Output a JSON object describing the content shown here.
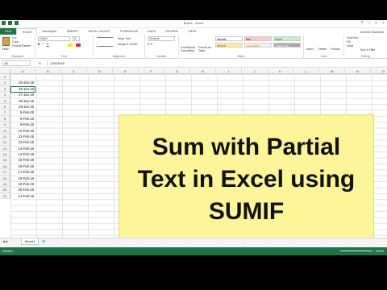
{
  "window": {
    "title": "Book1 - Excel",
    "controls": [
      "?",
      "–",
      "□",
      "×"
    ]
  },
  "ribbon_tabs": {
    "file": "FILE",
    "tabs": [
      "HOME",
      "Developer",
      "INSERT",
      "PAGE LAYOUT",
      "FORMULAS",
      "DATA",
      "REVIEW",
      "VIEW"
    ],
    "user": "Umesh Mohanta"
  },
  "ribbon": {
    "clipboard": {
      "paste": "Paste",
      "cut": "Cut",
      "copy": "Copy",
      "format_painter": "Format Painter",
      "label": "Clipboard"
    },
    "font": {
      "name": "Calibri",
      "size": "11",
      "label": "Font"
    },
    "alignment": {
      "wrap": "Wrap Text",
      "merge": "Merge & Center",
      "label": "Alignment"
    },
    "number": {
      "format": "General",
      "label": "Number"
    },
    "styles": {
      "conditional": "Conditional Formatting",
      "format_table": "Format as Table",
      "cells": [
        "Normal",
        "Bad",
        "Good",
        "Neutral",
        "Calculation",
        "Check Cell"
      ],
      "label": "Styles"
    },
    "cells": {
      "insert": "Insert",
      "delete": "Delete",
      "format": "Format",
      "label": "Cells"
    },
    "editing": {
      "autosum": "AutoSum",
      "fill": "Fill",
      "clear": "Clear",
      "sort": "Sort & Filter",
      "find": "Find & Select",
      "label": "Editing"
    }
  },
  "formula_bar": {
    "name_box": "A3",
    "fx": "fx",
    "value": "1/26/2018"
  },
  "columns": [
    "A",
    "B",
    "C",
    "D",
    "E",
    "F",
    "G",
    "H",
    "I",
    "J",
    "K",
    "L",
    "M",
    "N",
    "O"
  ],
  "rows": [
    "1",
    "2",
    "3",
    "4",
    "5",
    "6",
    "7",
    "8",
    "9",
    "10",
    "11",
    "12",
    "13",
    "14",
    "15",
    "16",
    "17",
    "18",
    "19",
    "20",
    "21"
  ],
  "column_a": [
    "",
    "25-Jan-18",
    "26-Jan-18",
    "27-Jan-18",
    "28-Jan-18",
    "29-Jan-18",
    "6-Feb-18",
    "8-Feb-18",
    "9-Feb-18",
    "10-Feb-18",
    "11-Feb-18",
    "12-Feb-18",
    "13-Feb-18",
    "14-Feb-18",
    "15-Feb-18",
    "16-Feb-18",
    "17-Feb-18",
    "18-Feb-18",
    "19-Feb-18",
    "20-Feb-18",
    "21-Feb-18"
  ],
  "overlay": {
    "line1": "Sum with Partial",
    "line2": "Text in Excel using",
    "line3": "SUMIF"
  },
  "sheet_tab": "Sheet1",
  "status": {
    "ready": "READY",
    "zoom": "100%"
  }
}
